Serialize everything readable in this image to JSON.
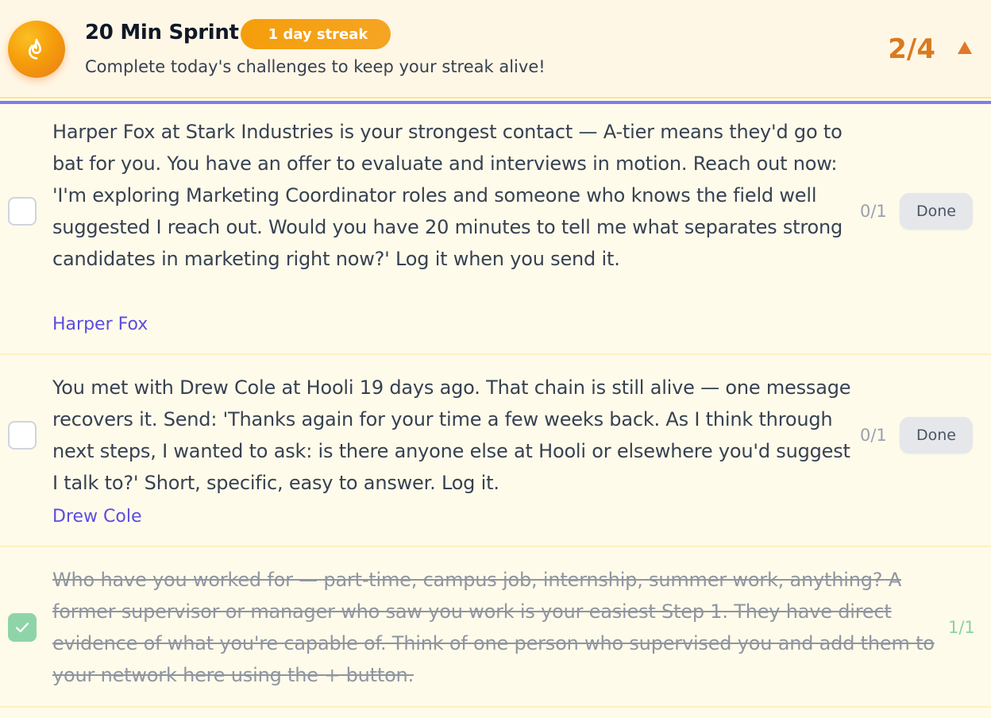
{
  "header": {
    "icon": "flame-icon",
    "title": "20 Min Sprint",
    "streak_label": "1 day streak",
    "subtitle": "Complete today's challenges to keep your streak alive!",
    "progress": "2/4",
    "toggle_icon": "caret-up-icon"
  },
  "colors": {
    "accent_orange": "#f59e0b",
    "progress_text": "#d97a20",
    "divider": "#6366f1",
    "contact_link": "#5b4de0",
    "check_green": "#8fd4a9"
  },
  "challenges": [
    {
      "text": "Harper Fox at Stark Industries is your strongest contact — A-tier means they'd go to bat for you. You have an offer to evaluate and interviews in motion. Reach out now: 'I'm exploring Marketing Coordinator roles and someone who knows the field well suggested I reach out. Would you have 20 minutes to tell me what separates strong candidates in marketing right now?' Log it when you send it.",
      "contact": "Harper Fox",
      "count": "0/1",
      "button": "Done",
      "completed": false
    },
    {
      "text": "You met with Drew Cole at Hooli 19 days ago. That chain is still alive — one message recovers it. Send: 'Thanks again for your time a few weeks back. As I think through next steps, I wanted to ask: is there anyone else at Hooli or elsewhere you'd suggest I talk to?' Short, specific, easy to answer. Log it.",
      "contact": "Drew Cole",
      "count": "0/1",
      "button": "Done",
      "completed": false
    },
    {
      "text": "Who have you worked for — part-time, campus job, internship, summer work, anything? A former supervisor or manager who saw you work is your easiest Step 1. They have direct evidence of what you're capable of. Think of one person who supervised you and add them to your network here using the + button.",
      "count": "1/1",
      "completed": true
    }
  ]
}
